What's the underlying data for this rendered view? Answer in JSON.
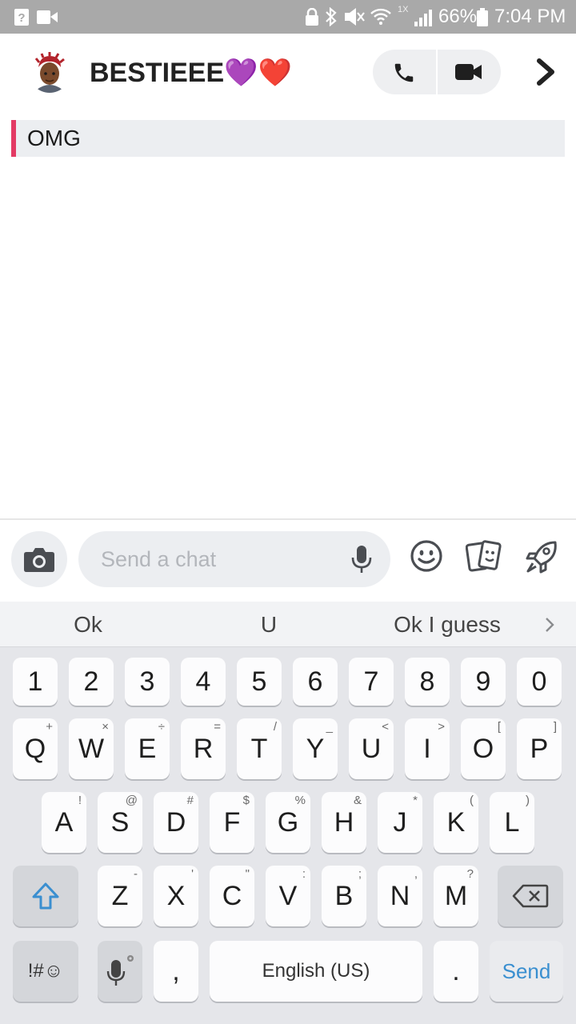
{
  "status_bar": {
    "battery": "66%",
    "time": "7:04 PM",
    "signal_badge": "1X"
  },
  "header": {
    "chat_name": "BESTIEEE💜❤️"
  },
  "messages": [
    {
      "text": "OMG",
      "accent_color": "#e33a64"
    }
  ],
  "chat_bar": {
    "placeholder": "Send a chat"
  },
  "keyboard": {
    "suggestions": [
      "Ok",
      "U",
      "Ok I guess"
    ],
    "number_row": [
      "1",
      "2",
      "3",
      "4",
      "5",
      "6",
      "7",
      "8",
      "9",
      "0"
    ],
    "row1": [
      {
        "k": "Q",
        "h": "+"
      },
      {
        "k": "W",
        "h": "×"
      },
      {
        "k": "E",
        "h": "÷"
      },
      {
        "k": "R",
        "h": "="
      },
      {
        "k": "T",
        "h": "/"
      },
      {
        "k": "Y",
        "h": "_"
      },
      {
        "k": "U",
        "h": "<"
      },
      {
        "k": "I",
        "h": ">"
      },
      {
        "k": "O",
        "h": "["
      },
      {
        "k": "P",
        "h": "]"
      }
    ],
    "row2": [
      {
        "k": "A",
        "h": "!"
      },
      {
        "k": "S",
        "h": "@"
      },
      {
        "k": "D",
        "h": "#"
      },
      {
        "k": "F",
        "h": "$"
      },
      {
        "k": "G",
        "h": "%"
      },
      {
        "k": "H",
        "h": "&"
      },
      {
        "k": "J",
        "h": "*"
      },
      {
        "k": "K",
        "h": "("
      },
      {
        "k": "L",
        "h": ")"
      }
    ],
    "row3": [
      {
        "k": "Z",
        "h": "-"
      },
      {
        "k": "X",
        "h": "'"
      },
      {
        "k": "C",
        "h": "\""
      },
      {
        "k": "V",
        "h": ":"
      },
      {
        "k": "B",
        "h": ";"
      },
      {
        "k": "N",
        "h": ","
      },
      {
        "k": "M",
        "h": "?"
      }
    ],
    "symbols_label": "!#☺",
    "comma": ",",
    "space_label": "English (US)",
    "period": ".",
    "send_label": "Send"
  },
  "colors": {
    "status_bar": "#a9a9a9",
    "accent_pink": "#e33a64",
    "send_blue": "#3a8fd0",
    "shift_blue": "#3a8fd0"
  }
}
